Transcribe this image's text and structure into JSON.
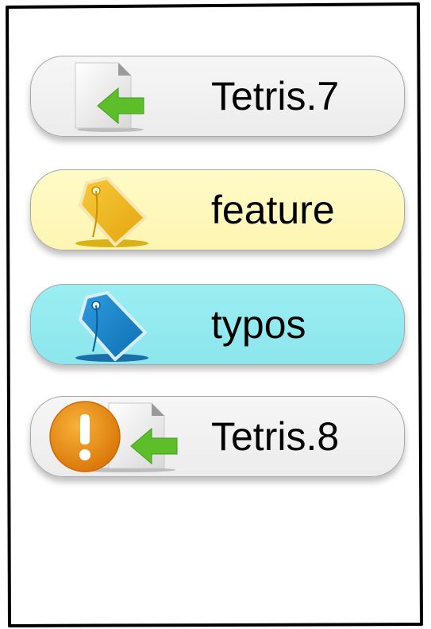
{
  "items": [
    {
      "label": "Tetris.7",
      "icon": "file-import-icon",
      "background": "#efefef"
    },
    {
      "label": "feature",
      "icon": "tag-yellow-icon",
      "background": "#fef8b8"
    },
    {
      "label": "typos",
      "icon": "tag-blue-icon",
      "background": "#92eaef"
    },
    {
      "label": "Tetris.8",
      "icon": "file-import-warning-icon",
      "background": "#efefef"
    }
  ],
  "colors": {
    "frame": "#000000",
    "arrow_green": "#5cbf2a",
    "tag_yellow": "#f2b418",
    "tag_blue": "#1a86c8",
    "warning_orange": "#e98a12"
  }
}
